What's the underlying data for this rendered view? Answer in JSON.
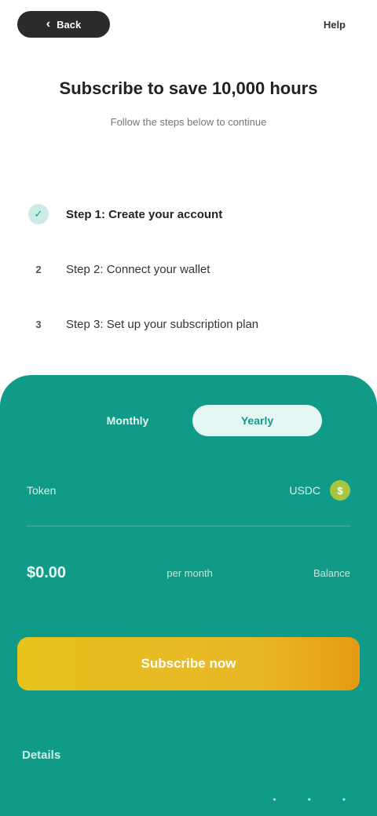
{
  "topbar": {
    "back_label": "Back",
    "back_icon": "chevron-left-icon",
    "right_label": "Help"
  },
  "header": {
    "headline": "Subscribe to save 10,000 hours",
    "subline": "Follow the steps below to continue"
  },
  "steps": [
    {
      "marker": "✓",
      "label": "Step 1: Create your account",
      "state": "done"
    },
    {
      "marker": "2",
      "label": "Step 2: Connect your wallet",
      "state": "pending"
    },
    {
      "marker": "3",
      "label": "Step 3: Set up your subscription plan",
      "state": "pending"
    }
  ],
  "panel": {
    "tabs": [
      {
        "label": "Monthly",
        "active": false
      },
      {
        "label": "Yearly",
        "active": true
      }
    ],
    "row1": {
      "left": "Token",
      "right": "USDC"
    },
    "row2": {
      "left": "$0.00",
      "mid": "per month",
      "right": "Balance"
    },
    "cta_label": "Subscribe now",
    "bottom_label": "Details",
    "bottom_icons": [
      "•",
      "•",
      "•"
    ]
  },
  "colors": {
    "accent": "#0f9b87",
    "cta": "#e8b727"
  }
}
